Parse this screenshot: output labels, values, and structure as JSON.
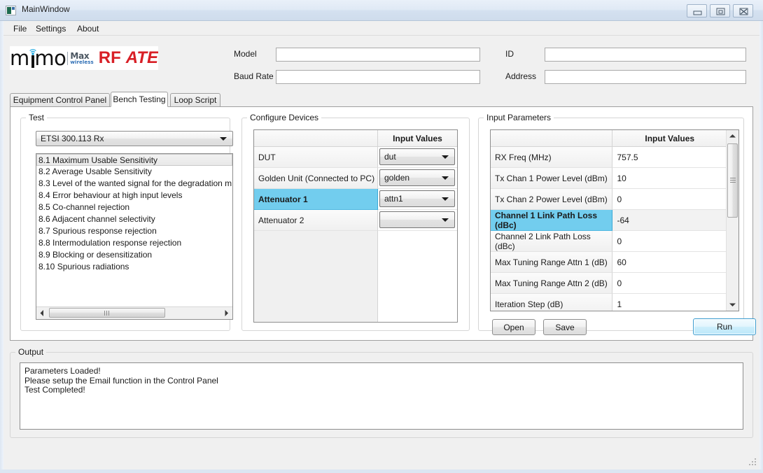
{
  "window": {
    "title": "MainWindow",
    "buttons": {
      "minimize": "minimize",
      "maximize": "maximize",
      "close": "close"
    }
  },
  "menu": {
    "items": [
      "File",
      "Settings",
      "About"
    ]
  },
  "branding": {
    "mimo_part1": "m",
    "mimo_part2": "mo",
    "max": "Max",
    "wireless": "wireless",
    "rf": "RF",
    "ate": "ATE"
  },
  "header": {
    "fields": [
      {
        "label": "Model",
        "value": "",
        "placeholder": ""
      },
      {
        "label": "Baud Rate",
        "value": "",
        "placeholder": ""
      },
      {
        "label": "ID",
        "value": "",
        "placeholder": ""
      },
      {
        "label": "Address",
        "value": "",
        "placeholder": ""
      }
    ]
  },
  "tabs": [
    {
      "label": "Equipment Control Panel",
      "active": false
    },
    {
      "label": "Bench Testing",
      "active": true
    },
    {
      "label": "Loop Script",
      "active": false
    }
  ],
  "test_group": {
    "title": "Test",
    "selected_standard": "ETSI 300.113 Rx",
    "items": [
      "8.1 Maximum Usable Sensitivity",
      "8.2 Average Usable Sensitivity",
      "8.3 Level of the wanted signal for the degradation m",
      "8.4 Error behaviour at high input levels",
      "8.5 Co-channel rejection",
      "8.6 Adjacent channel selectivity",
      "8.7 Spurious response rejection",
      "8.8 Intermodulation response rejection",
      "8.9 Blocking or desensitization",
      "8.10 Spurious radiations"
    ],
    "selected_index": 0
  },
  "configure_devices": {
    "title": "Configure Devices",
    "columns": [
      "",
      "Input Values"
    ],
    "rows": [
      {
        "label": "DUT",
        "value": "dut",
        "highlighted": false
      },
      {
        "label": "Golden Unit (Connected to PC)",
        "value": "golden",
        "highlighted": false
      },
      {
        "label": "Attenuator 1",
        "value": "attn1",
        "highlighted": true
      },
      {
        "label": "Attenuator 2",
        "value": "",
        "highlighted": false
      }
    ]
  },
  "input_parameters": {
    "title": "Input Parameters",
    "columns": [
      "",
      "Input Values"
    ],
    "rows": [
      {
        "label": "RX Freq (MHz)",
        "value": "757.5",
        "highlighted": false
      },
      {
        "label": "Tx Chan 1 Power Level (dBm)",
        "value": "10",
        "highlighted": false
      },
      {
        "label": "Tx Chan 2 Power Level (dBm)",
        "value": "0",
        "highlighted": false
      },
      {
        "label": "Channel 1 Link Path Loss (dBc)",
        "value": "-64",
        "highlighted": true
      },
      {
        "label": "Channel 2 Link Path Loss (dBc)",
        "value": "0",
        "highlighted": false
      },
      {
        "label": "Max Tuning Range Attn 1 (dB)",
        "value": "60",
        "highlighted": false
      },
      {
        "label": "Max Tuning Range Attn 2 (dB)",
        "value": "0",
        "highlighted": false
      },
      {
        "label": "Iteration Step (dB)",
        "value": "1",
        "highlighted": false
      }
    ],
    "buttons": {
      "open": "Open",
      "save": "Save",
      "run": "Run"
    }
  },
  "output": {
    "title": "Output",
    "lines": [
      "Parameters Loaded!",
      "Please setup the Email function in the Control Panel",
      "Test Completed!"
    ]
  },
  "colors": {
    "highlight": "#72cdee",
    "accent_red": "#d81f26",
    "primary_button_border": "#3c9dd0",
    "window_bg": "#f0f0f0"
  }
}
